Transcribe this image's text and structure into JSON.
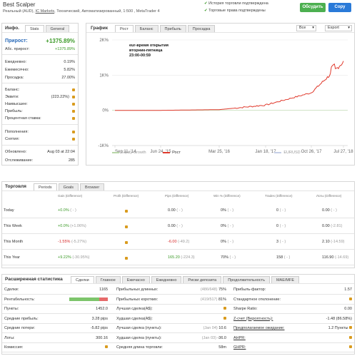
{
  "header": {
    "title": "Best Scalper",
    "subtitle_prefix": "Реальный (AUD),",
    "broker": "IC Markets",
    "subtitle_suffix": ", Технический, Автоматизированный, 1:500 , MetaTrader 4",
    "check1": "История торговли подтверждена",
    "check2": "Торговые права подтверждены",
    "subscribe": "Обсудить",
    "copy": "Copy"
  },
  "info": {
    "title": "Инфо.",
    "tabs": [
      "Stats",
      "General"
    ],
    "gain_label": "Прирост:",
    "gain_value": "+1375.89%",
    "abs_label": "Абс. прирост:",
    "abs_value": "+1375.89%",
    "daily_label": "Ежедневно:",
    "daily_value": "0.19%",
    "monthly_label": "Ежемесячно:",
    "monthly_value": "5.82%",
    "dd_label": "Просадка:",
    "dd_value": "27.00%",
    "balance_label": "Баланс:",
    "equity_label": "Эквити:",
    "equity_value": "(223.22%)",
    "highest_label": "Наивысшее:",
    "profit_label": "Прибыль:",
    "interest_label": "Процентная ставка:",
    "deposits_label": "Пополнения:",
    "withdrawals_label": "Снятия:",
    "updated_label": "Обновлено:",
    "updated_value": "Aug 03 at 22:04",
    "tracking_label": "Отслеживание:",
    "tracking_value": "285"
  },
  "chart": {
    "title": "График",
    "tabs": [
      "Рост",
      "Баланс",
      "Прибыль",
      "Просадка"
    ],
    "select1": "Все",
    "select2": "Export",
    "annotation": [
      "eur-время открытия",
      "вторник-пятница",
      "23:00-00:59"
    ]
  },
  "chart_data": {
    "type": "line",
    "x": [
      "Sep 11, '14",
      "Jun 24, '15",
      "Mar 25, '16",
      "Jan 18, '17",
      "Oct 26, '17",
      "Jul 27, '18"
    ],
    "yticks": [
      "2K%",
      "1K%",
      "0%",
      "-1K%"
    ],
    "ylim": [
      -1000,
      2000
    ],
    "series": [
      {
        "name": "Equity Growth",
        "color": "#b8d6a8",
        "values": [
          0,
          0,
          0,
          0,
          0,
          0
        ]
      },
      {
        "name": "Рост",
        "color": "#e0392c",
        "values": [
          0,
          0,
          20,
          150,
          500,
          1376
        ]
      },
      {
        "name": "EURUSD",
        "color": "#c5cfe6",
        "values": [
          0,
          0,
          0,
          0,
          0,
          0
        ]
      }
    ]
  },
  "trading": {
    "title": "Торговля",
    "tabs": [
      "Periods",
      "Goals",
      "Browser"
    ],
    "headers": [
      "Gain (Difference)",
      "Profit (Difference)",
      "Pips (Difference)",
      "Win % (Difference)",
      "Trades (Difference)",
      "Лоты (Difference)"
    ],
    "rows": [
      {
        "period": "Today",
        "gain": "+0.0%",
        "gain_diff": "( - )",
        "pips": "0.00",
        "pips_diff": "( - )",
        "win": "0%",
        "win_diff": "( - )",
        "trades": "0",
        "trades_diff": "( - )",
        "lots": "0.00",
        "lots_diff": "( - )"
      },
      {
        "period": "This Week",
        "gain": "+0.0%",
        "gain_diff": "(+1.06%)",
        "pips": "0.00",
        "pips_diff": "( - )",
        "win": "0%",
        "win_diff": "( - )",
        "trades": "0",
        "trades_diff": "( - )",
        "lots": "0.00",
        "lots_diff": "(-2.81)"
      },
      {
        "period": "This Month",
        "gain": "-1.55%",
        "gain_diff": "(-5.27%)",
        "pips": "-6.00",
        "pips_diff": "(-49.2)",
        "win": "0%",
        "win_diff": "( - )",
        "trades": "3",
        "trades_diff": "( - )",
        "lots": "2.10",
        "lots_diff": "(-14.59)"
      },
      {
        "period": "This Year",
        "gain": "+9.22%",
        "gain_diff": "(-30.95%)",
        "pips": "165.20",
        "pips_diff": "(-224.3)",
        "win": "70%",
        "win_diff": "( - )",
        "trades": "158",
        "trades_diff": "( - )",
        "lots": "116.90",
        "lots_diff": "(-14.69)"
      }
    ]
  },
  "stats": {
    "title": "Расширенная статистика",
    "tabs": [
      "Сделки",
      "Главное",
      "Ежечасно",
      "Ежедневно",
      "Риски депозита",
      "Продолжительность",
      "MAE/MFE"
    ],
    "col1": [
      {
        "l": "Сделки:",
        "v": "1165"
      },
      {
        "l": "Рентабельность:",
        "v": ""
      },
      {
        "l": "Пункты:",
        "v": "1452.0"
      },
      {
        "l": "Средние прибыль:",
        "v": "3.28 pips"
      },
      {
        "l": "Средние потери:",
        "v": "-5.82 pips"
      },
      {
        "l": "Лоты:",
        "v": "300.16"
      },
      {
        "l": "Комиссия:",
        "v": ""
      }
    ],
    "col2": [
      {
        "l": "Прибыльных длинных:",
        "d": "(486/648)",
        "v": "75%"
      },
      {
        "l": "Прибыльных коротких:",
        "d": "(419/517)",
        "v": "81%"
      },
      {
        "l": "Лучшая сделка(A$):",
        "d": "",
        "v": ""
      },
      {
        "l": "Худшая сделка(A$):",
        "d": "",
        "v": ""
      },
      {
        "l": "Лучшая сделка (пункты):",
        "d": "(Jan 04)",
        "v": "10.6"
      },
      {
        "l": "Худшая сделка (пункты):",
        "d": "(Jan 03)",
        "v": "-36.0"
      },
      {
        "l": "Средняя длина торговли:",
        "d": "",
        "v": "58m"
      }
    ],
    "col3": [
      {
        "l": "Прибыль-фактор:",
        "v": "1.57"
      },
      {
        "l": "Стандартное отклонение:",
        "v": ""
      },
      {
        "l": "Sharpe Ratio:",
        "v": "0.00"
      },
      {
        "l": "Z-счет (Вероятность):",
        "v": "-1.48 (86.58%)"
      },
      {
        "l": "Предполагаемое ожидание:",
        "v": "1.2 Пункты"
      },
      {
        "l": "AHPR:",
        "v": ""
      },
      {
        "l": "GHPR:",
        "v": ""
      }
    ]
  },
  "colors": {
    "green": "#3c9a28",
    "red": "#d62b2b",
    "subscribe": "#4caf50",
    "copy": "#2a7ad8"
  }
}
